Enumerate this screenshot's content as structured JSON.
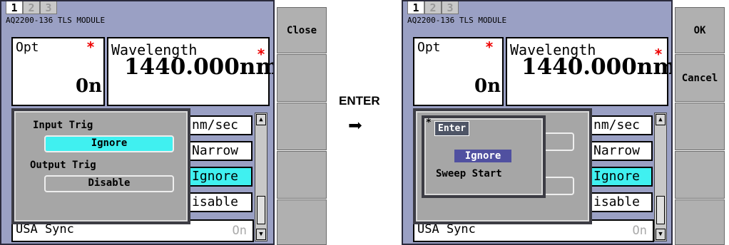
{
  "tabs": [
    "1",
    "2",
    "3"
  ],
  "module_name": "AQ2200-136 TLS MODULE",
  "opt_label": "Opt",
  "opt_value": "0n",
  "star": "*",
  "wavelength_label": "Wavelength",
  "wavelength_value": "1440.000nm",
  "rows": [
    "nm/sec",
    "Narrow",
    "Ignore",
    "isable"
  ],
  "usa_sync_label": "USA Sync",
  "usa_sync_value": "On",
  "left": {
    "side_buttons": [
      "Close"
    ],
    "dialog": {
      "input_trig_label": "Input Trig",
      "input_trig_value": "Ignore",
      "output_trig_label": "Output Trig",
      "output_trig_value": "Disable"
    }
  },
  "arrow_label": "ENTER",
  "right": {
    "side_buttons": [
      "OK",
      "Cancel"
    ],
    "popup": {
      "mark": "*",
      "title": "Enter",
      "options": [
        "Ignore",
        "Sweep Start"
      ],
      "selected": "Ignore"
    }
  },
  "colors": {
    "screen_bg": "#9aa0c4",
    "highlight_cyan": "#40f0f0",
    "selected_option_bg": "#5050a0",
    "star_red": "#e00000"
  },
  "icons": {
    "scroll_up": "▲",
    "scroll_down": "▼",
    "arrow": "➡"
  }
}
